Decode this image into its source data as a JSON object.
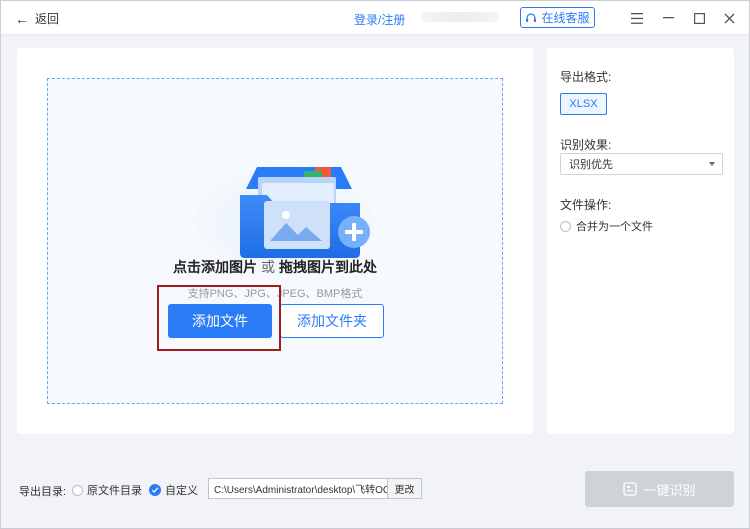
{
  "titlebar": {
    "back_label": "返回",
    "login_label": "登录/注册",
    "service_label": "在线客服"
  },
  "dropzone": {
    "hint_main": "点击添加图片",
    "hint_or": "或",
    "hint_drag": "拖拽图片到此处",
    "formats": "支持PNG、JPG、JPEG、BMP格式",
    "add_file_label": "添加文件",
    "add_folder_label": "添加文件夹"
  },
  "side": {
    "export_format_label": "导出格式:",
    "export_format_value": "XLSX",
    "recognize_effect_label": "识别效果:",
    "recognize_effect_value": "识别优先",
    "file_ops_label": "文件操作:",
    "merge_label": "合并为一个文件"
  },
  "footer": {
    "export_dir_label": "导出目录:",
    "original_dir_label": "原文件目录",
    "custom_label": "自定义",
    "path_value": "C:\\Users\\Administrator\\desktop\\飞转OCR文",
    "change_label": "更改",
    "ocr_label": "一键识别"
  },
  "colors": {
    "accent": "#2a7cf6",
    "highlight": "#a01b1b",
    "disabled": "#cfd3d8"
  }
}
